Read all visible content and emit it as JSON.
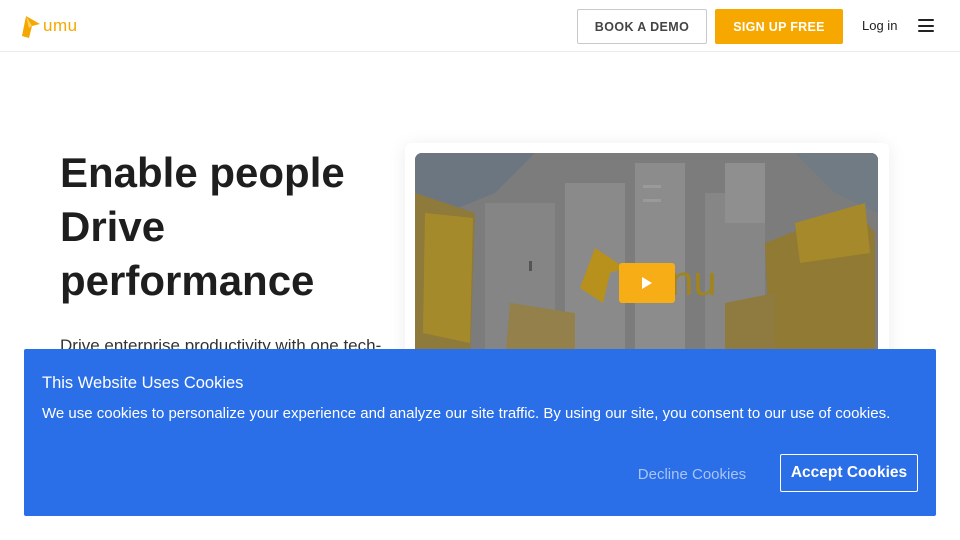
{
  "header": {
    "logo_text": "umu",
    "book_demo_label": "BOOK A DEMO",
    "sign_up_label": "SIGN UP FREE",
    "login_label": "Log in",
    "menu_icon": "hamburger-menu-icon"
  },
  "hero": {
    "title_lines": [
      "Enable people",
      "Drive",
      "performance"
    ],
    "subtitle": "Drive enterprise productivity with one tech-"
  },
  "video": {
    "logo_text": "nu",
    "play_icon": "play-icon"
  },
  "cookie_banner": {
    "title": "This Website Uses Cookies",
    "text": "We use cookies to personalize your experience and analyze our site traffic. By using our site, you consent to our use of cookies.",
    "decline_label": "Decline Cookies",
    "accept_label": "Accept Cookies"
  },
  "colors": {
    "brand": "#f7a800",
    "banner": "#2a6ee8"
  }
}
